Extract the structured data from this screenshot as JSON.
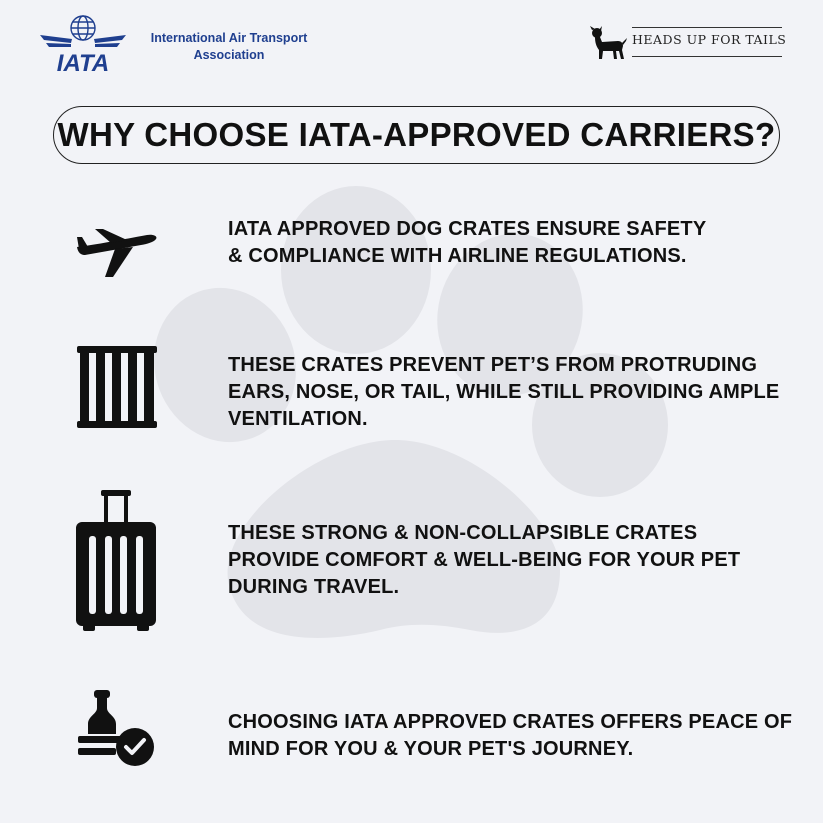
{
  "header": {
    "iata": {
      "logo_text": "IATA",
      "org_name_line1": "International Air Transport",
      "org_name_line2": "Association"
    },
    "brand": {
      "name": "HEADS UP FOR TAILS"
    }
  },
  "title": "WHY CHOOSE IATA-APPROVED CARRIERS?",
  "features": [
    {
      "icon": "airplane-icon",
      "lines": [
        "IATA APPROVED DOG CRATES ENSURE SAFETY",
        "& COMPLIANCE WITH AIRLINE REGULATIONS."
      ]
    },
    {
      "icon": "crate-icon",
      "lines": [
        "THESE CRATES PREVENT PET’S FROM PROTRUDING",
        "EARS, NOSE, OR TAIL, WHILE STILL PROVIDING AMPLE",
        "VENTILATION."
      ]
    },
    {
      "icon": "luggage-icon",
      "lines": [
        "THESE STRONG & NON-COLLAPSIBLE CRATES",
        "PROVIDE COMFORT & WELL-BEING FOR YOUR PET",
        "DURING TRAVEL."
      ]
    },
    {
      "icon": "approved-stamp-icon",
      "lines": [
        "CHOOSING IATA APPROVED CRATES OFFERS PEACE OF",
        "MIND FOR YOU & YOUR PET'S JOURNEY."
      ]
    }
  ],
  "colors": {
    "background": "#f2f3f7",
    "paw_watermark": "#e3e4e9",
    "iata_blue": "#1f3f8f",
    "text": "#111111"
  }
}
